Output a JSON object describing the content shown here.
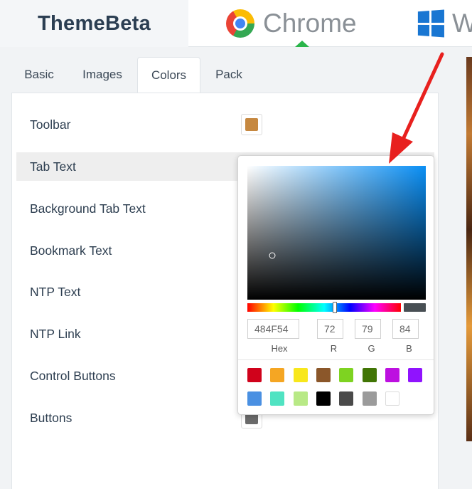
{
  "header": {
    "brand": "ThemeBeta",
    "tabs": [
      {
        "label": "Chrome"
      },
      {
        "label": "W"
      }
    ]
  },
  "editor_tabs": [
    "Basic",
    "Images",
    "Colors",
    "Pack"
  ],
  "color_rows": [
    {
      "label": "Toolbar",
      "swatch": "#c68840",
      "active": false
    },
    {
      "label": "Tab Text",
      "swatch": "#484F54",
      "active": true
    },
    {
      "label": "Background Tab Text",
      "swatch": "#6b6b6b",
      "active": false
    },
    {
      "label": "Bookmark Text",
      "swatch": "#6b6b6b",
      "active": false
    },
    {
      "label": "NTP Text",
      "swatch": "#6b6b6b",
      "active": false
    },
    {
      "label": "NTP Link",
      "swatch": "#6b6b6b",
      "active": false
    },
    {
      "label": "Control Buttons",
      "swatch": "#6b6b6b",
      "active": false
    },
    {
      "label": "Buttons",
      "swatch": "#6b6b6b",
      "active": false
    }
  ],
  "picker": {
    "hue_color": "#0a8ff5",
    "hue_fraction": 0.57,
    "saturation": 0.14,
    "value": 0.33,
    "hex": "484F54",
    "r": "72",
    "g": "79",
    "b": "84",
    "hex_label": "Hex",
    "r_label": "R",
    "g_label": "G",
    "b_label": "B",
    "preview": "#484F54",
    "presets": [
      "#d0021b",
      "#f5a623",
      "#f8e71c",
      "#8b572a",
      "#7ed321",
      "#417505",
      "#bd10e0",
      "#9013fe",
      "#4a90e2",
      "#50e3c2",
      "#b8e986",
      "#000000",
      "#4a4a4a",
      "#9b9b9b",
      "#ffffff"
    ]
  },
  "annotation": {
    "arrow_color": "#e8201e"
  }
}
